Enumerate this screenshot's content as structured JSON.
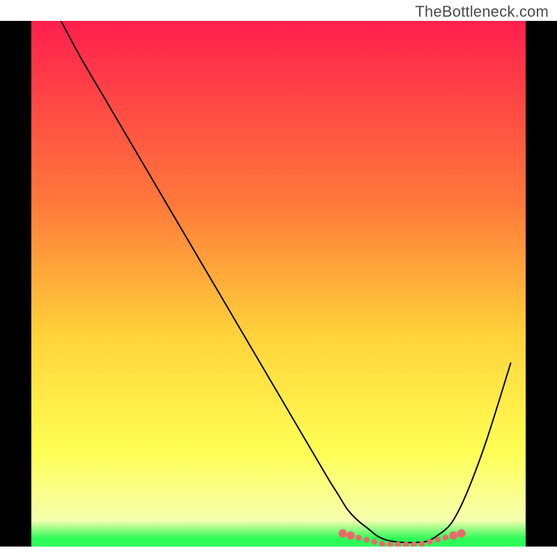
{
  "watermark": "TheBottleneck.com",
  "chart_data": {
    "type": "line",
    "title": "",
    "xlabel": "",
    "ylabel": "",
    "xlim": [
      0,
      100
    ],
    "ylim": [
      0,
      100
    ],
    "grid": false,
    "legend": false,
    "background": {
      "type": "vertical-gradient",
      "stops": [
        {
          "pos": 0.0,
          "color": "#ff1f4e"
        },
        {
          "pos": 0.35,
          "color": "#ff7a3a"
        },
        {
          "pos": 0.6,
          "color": "#ffd33a"
        },
        {
          "pos": 0.82,
          "color": "#ffff55"
        },
        {
          "pos": 0.95,
          "color": "#f6ffae"
        },
        {
          "pos": 0.985,
          "color": "#2dfb57"
        },
        {
          "pos": 1.0,
          "color": "#2dfb57"
        }
      ]
    },
    "series": [
      {
        "name": "bottleneck-curve",
        "x": [
          6,
          10,
          15,
          20,
          25,
          30,
          35,
          40,
          45,
          50,
          55,
          60,
          62,
          64,
          66,
          68,
          70,
          72,
          75,
          78,
          80,
          82,
          85,
          88,
          92,
          97
        ],
        "y": [
          100,
          93,
          85,
          77,
          69,
          61,
          53,
          45,
          37,
          29,
          21,
          13,
          10,
          7,
          5,
          3.5,
          2,
          1.2,
          0.8,
          0.8,
          1.0,
          2.0,
          4.5,
          10,
          20,
          35
        ],
        "stroke": "#000000",
        "stroke_width": 2
      }
    ],
    "markers": {
      "name": "highlight-dots",
      "style": "dotted-band",
      "color": "#e96a6a",
      "x_range": [
        63,
        87
      ],
      "y": 1.0
    },
    "frame": {
      "left_right_border_color": "#000000",
      "left_right_border_width_px": 45
    }
  }
}
